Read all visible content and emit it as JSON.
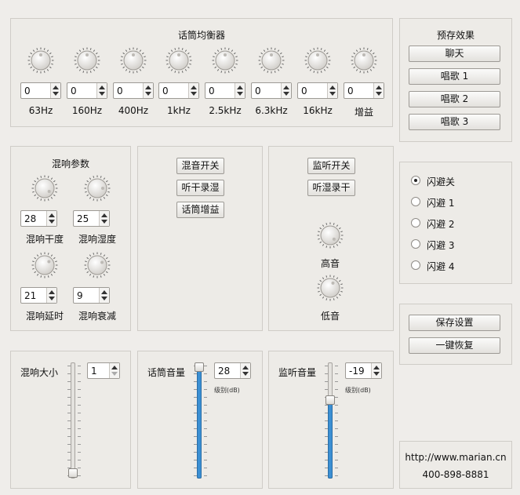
{
  "eq": {
    "title": "话筒均衡器",
    "bands": [
      {
        "label": "63Hz",
        "value": "0"
      },
      {
        "label": "160Hz",
        "value": "0"
      },
      {
        "label": "400Hz",
        "value": "0"
      },
      {
        "label": "1kHz",
        "value": "0"
      },
      {
        "label": "2.5kHz",
        "value": "0"
      },
      {
        "label": "6.3kHz",
        "value": "0"
      },
      {
        "label": "16kHz",
        "value": "0"
      },
      {
        "label": "增益",
        "value": "0"
      }
    ]
  },
  "preset": {
    "title": "预存效果",
    "buttons": [
      "聊天",
      "唱歌 1",
      "唱歌 2",
      "唱歌 3"
    ]
  },
  "reverb": {
    "title": "混响参数",
    "knobs": [
      {
        "label": "混响干度",
        "value": "28"
      },
      {
        "label": "混响湿度",
        "value": "25"
      },
      {
        "label": "混响延时",
        "value": "21"
      },
      {
        "label": "混响衰减",
        "value": "9"
      }
    ]
  },
  "mix": {
    "buttons": [
      "混音开关",
      "听干录湿",
      "话筒增益"
    ]
  },
  "monitor": {
    "buttons": [
      "监听开关",
      "听湿录干"
    ],
    "treble_label": "高音",
    "bass_label": "低音"
  },
  "ducking": {
    "options": [
      "闪避关",
      "闪避 1",
      "闪避 2",
      "闪避 3",
      "闪避 4"
    ],
    "selected_index": 0
  },
  "settings": {
    "save_label": "保存设置",
    "restore_label": "一键恢复"
  },
  "reverb_size": {
    "label": "混响大小",
    "value": "1",
    "level": 0.0
  },
  "mic_volume": {
    "label": "话筒音量",
    "value": "28",
    "unit": "级别(dB)",
    "level": 1.0
  },
  "monitor_volume": {
    "label": "监听音量",
    "value": "-19",
    "unit": "级别(dB)",
    "level": 0.7
  },
  "contact": {
    "url": "http://www.marian.cn",
    "phone": "400-898-8881"
  }
}
